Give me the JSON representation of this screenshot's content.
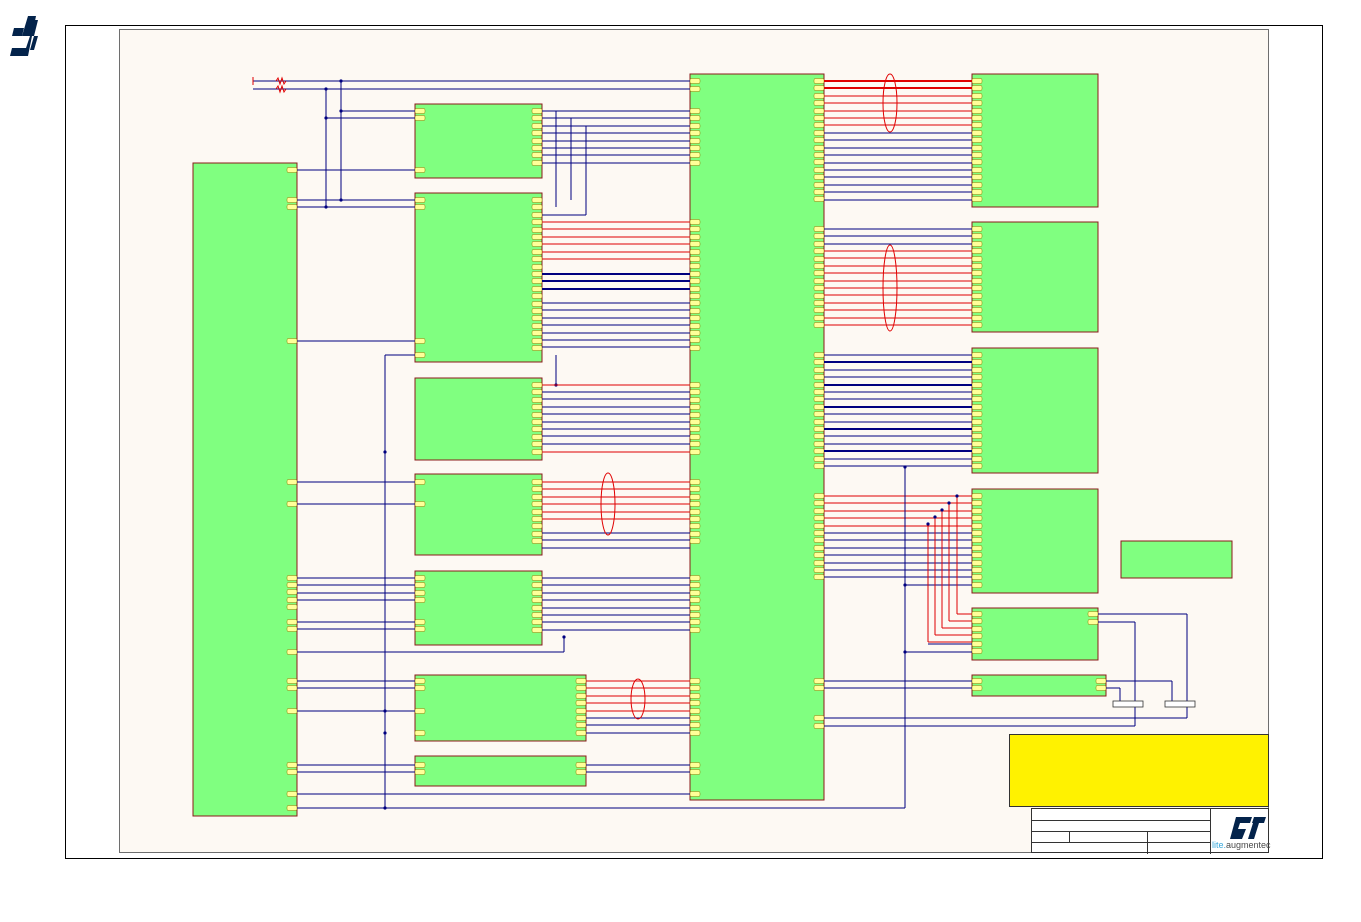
{
  "page": {
    "name": "schematic-block-diagram"
  },
  "brand": {
    "logo_icon": "st-logo-icon",
    "accent": "#03234b"
  },
  "title_block": {
    "brand_prefix": "lite.",
    "brand_suffix": "augmentec"
  },
  "colors": {
    "sheet": "#fdf9f3",
    "block_fill": "#80ff80",
    "block_border": "#8b1a1a",
    "pin": "#ffff99",
    "net_blue": "#00007f",
    "net_red": "#e00000",
    "note": "#fff200"
  }
}
